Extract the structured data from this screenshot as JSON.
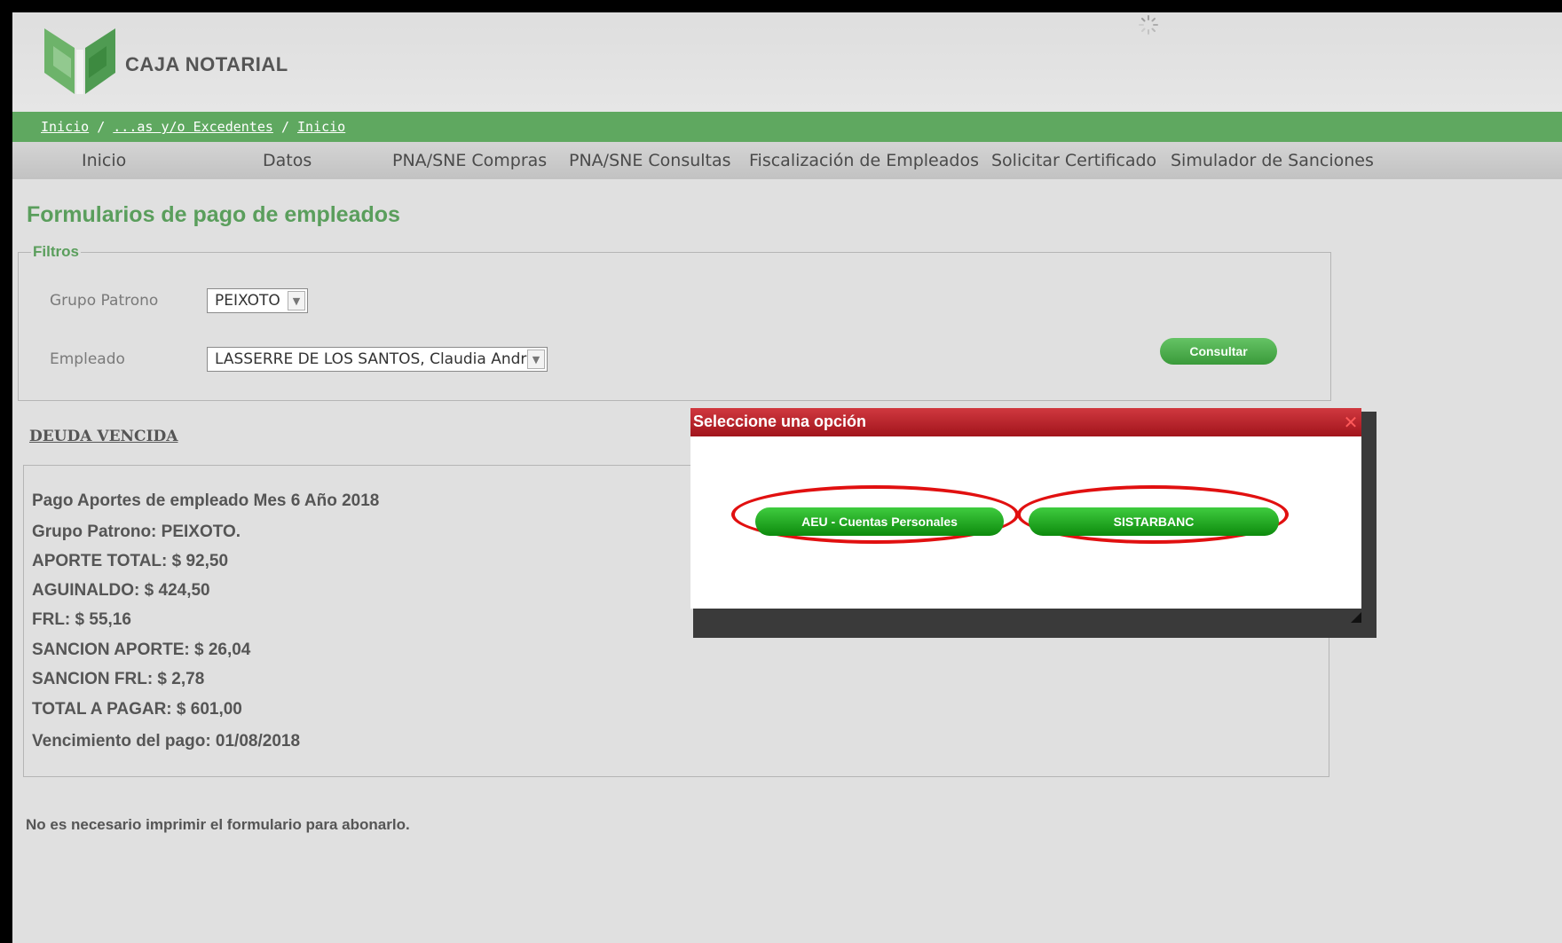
{
  "brand": {
    "name": "CAJA NOTARIAL"
  },
  "breadcrumb": [
    {
      "label": "Inicio"
    },
    {
      "label": "...as y/o Excedentes"
    },
    {
      "label": "Inicio"
    }
  ],
  "breadcrumb_separator": "/",
  "menu": [
    {
      "label": "Inicio"
    },
    {
      "label": "Datos"
    },
    {
      "label": "PNA/SNE Compras"
    },
    {
      "label": "PNA/SNE Consultas"
    },
    {
      "label": "Fiscalización de Empleados"
    },
    {
      "label": "Solicitar Certificado"
    },
    {
      "label": "Simulador de Sanciones"
    }
  ],
  "page_title": "Formularios de pago de empleados",
  "filters": {
    "legend": "Filtros",
    "grupo_label": "Grupo Patrono",
    "grupo_value": "PEIXOTO",
    "empleado_label": "Empleado",
    "empleado_value": "LASSERRE DE LOS SANTOS, Claudia Andrea",
    "consultar_label": "Consultar"
  },
  "deuda": {
    "title": "DEUDA VENCIDA",
    "lines": [
      "Pago Aportes de empleado Mes 6 Año 2018",
      "Grupo Patrono: PEIXOTO.",
      "APORTE TOTAL: $ 92,50",
      "AGUINALDO: $ 424,50",
      "FRL: $ 55,16",
      "SANCION APORTE: $ 26,04",
      "SANCION FRL: $ 2,78",
      "TOTAL A PAGAR: $ 601,00",
      "Vencimiento del pago: 01/08/2018"
    ]
  },
  "footer_note": "No es necesario imprimir el formulario para abonarlo.",
  "modal": {
    "title": "Seleccione una opción",
    "close_icon": "close-icon",
    "options": [
      {
        "label": "AEU - Cuentas Personales"
      },
      {
        "label": "SISTARBANC"
      }
    ]
  },
  "colors": {
    "brand_green": "#5fa860",
    "title_green": "#5a9e5c",
    "modal_red": "#b3202a",
    "button_green": "#1ea41e",
    "highlight_red": "#e11010"
  },
  "icons": {
    "logo": "caja-notarial-logo",
    "loading": "loading-spinner-icon"
  }
}
